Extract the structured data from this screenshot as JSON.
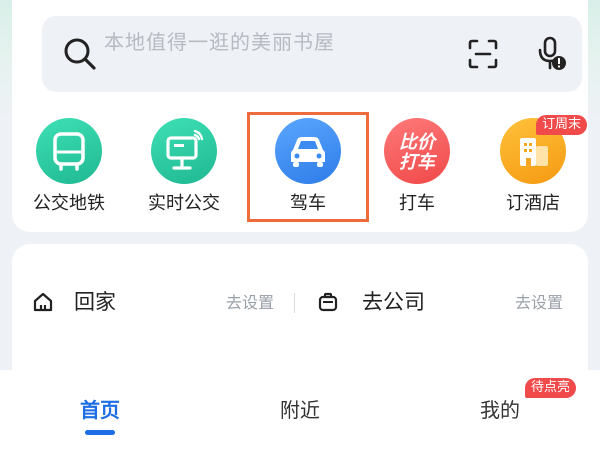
{
  "search": {
    "placeholder": "本地值得一逛的美丽书屋"
  },
  "quick_actions": [
    {
      "label": "公交地铁",
      "icon": "bus-icon",
      "color": "#2cc7a0"
    },
    {
      "label": "实时公交",
      "icon": "bus-stop-screen-icon",
      "color": "#2cc7a0"
    },
    {
      "label": "驾车",
      "icon": "car-icon",
      "color": "#3d8bf0"
    },
    {
      "label": "打车",
      "icon": "taxi-logo-icon",
      "color": "#f25656",
      "logo_text": "比价打车"
    },
    {
      "label": "订酒店",
      "icon": "hotel-icon",
      "color": "#f7a21b",
      "badge": "订周末"
    }
  ],
  "destinations": {
    "home": {
      "label": "回家",
      "action": "去设置",
      "icon": "home-icon"
    },
    "work": {
      "label": "去公司",
      "action": "去设置",
      "icon": "briefcase-icon"
    }
  },
  "tabbar": {
    "tabs": [
      {
        "label": "首页",
        "active": true
      },
      {
        "label": "附近",
        "active": false
      },
      {
        "label": "我的",
        "active": false,
        "badge": "待点亮"
      }
    ]
  },
  "colors": {
    "accent_blue": "#1e6ee6",
    "highlight_orange": "#ee6b3c",
    "badge_red": "#f04a4a"
  }
}
